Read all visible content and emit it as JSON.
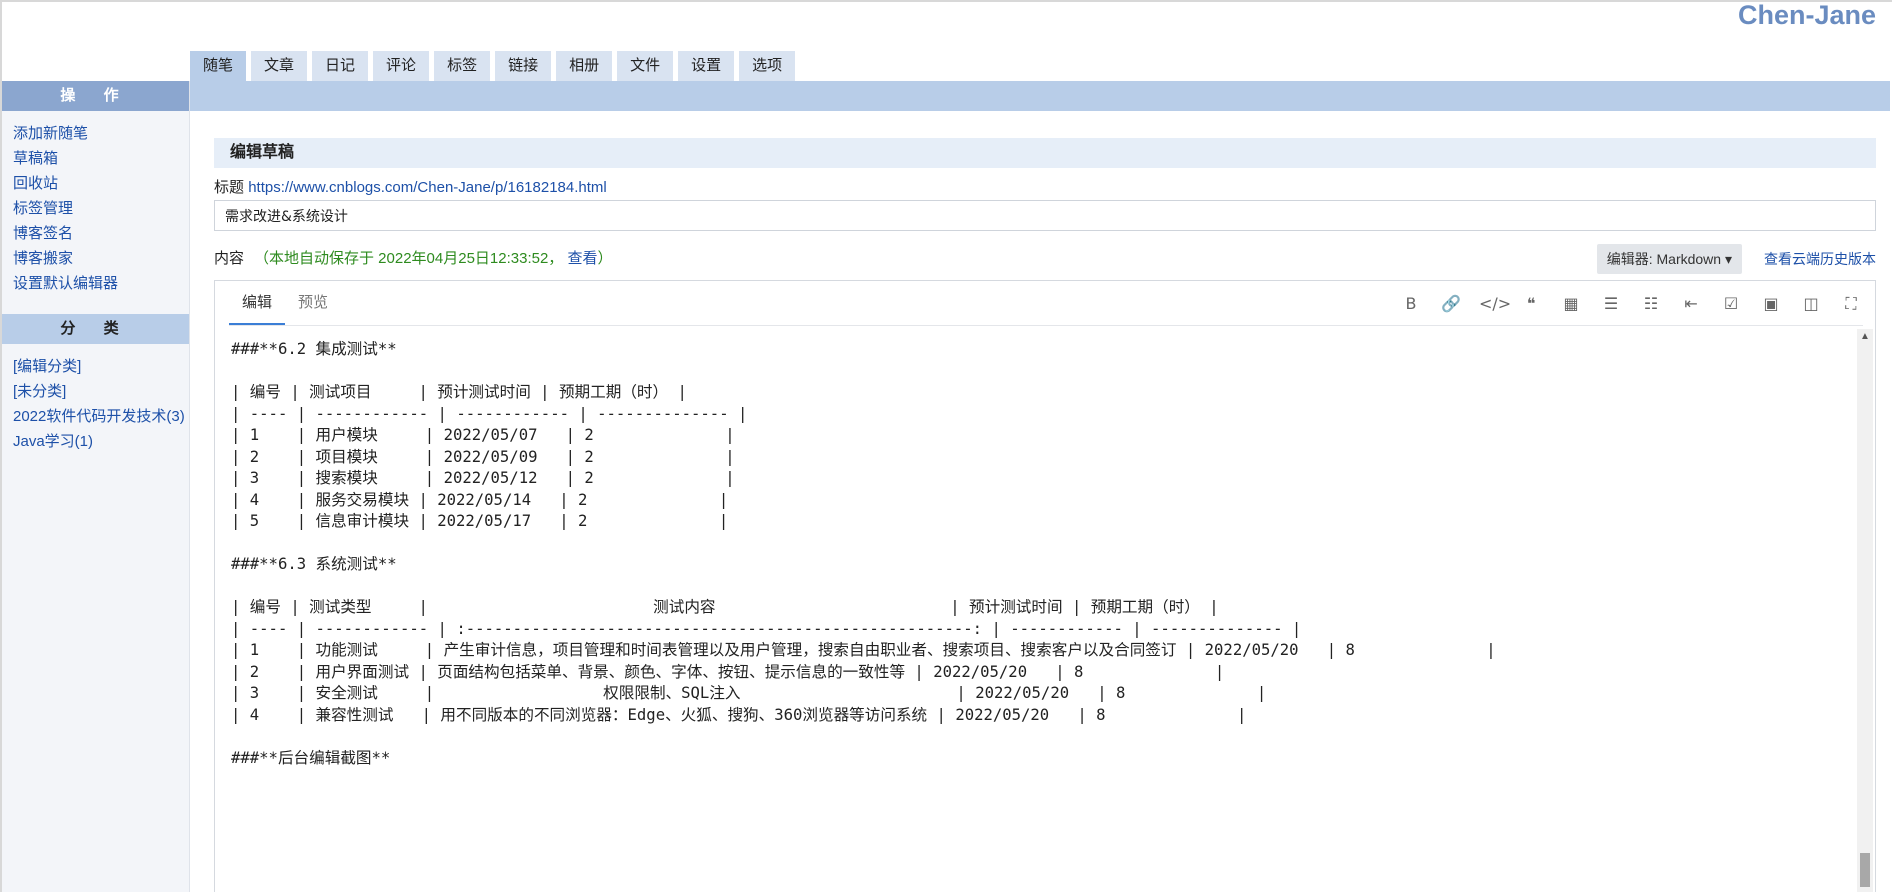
{
  "site_title": "Chen-Jane",
  "tabs": [
    "随笔",
    "文章",
    "日记",
    "评论",
    "标签",
    "链接",
    "相册",
    "文件",
    "设置",
    "选项"
  ],
  "sidebar": {
    "ops_title": "操 作",
    "ops": [
      "添加新随笔",
      "草稿箱",
      "回收站",
      "标签管理",
      "博客签名",
      "博客搬家",
      "设置默认编辑器"
    ],
    "cat_title": "分 类",
    "cats": [
      "[编辑分类]",
      "[未分类]",
      "2022软件代码开发技术(3)",
      "Java学习(1)"
    ]
  },
  "main": {
    "section_title": "编辑草稿",
    "title_label": "标题",
    "title_link": "https://www.cnblogs.com/Chen-Jane/p/16182184.html",
    "title_value": "需求改进&系统设计",
    "content_label": "内容",
    "autosave_prefix": "（本地自动保存于 2022年04月25日12:33:52，",
    "autosave_view": "查看",
    "autosave_suffix": "）",
    "editor_select": "编辑器: Markdown",
    "history_link": "查看云端历史版本"
  },
  "editor": {
    "tab_edit": "编辑",
    "tab_preview": "预览",
    "tools": [
      {
        "icon": "bold-icon",
        "glyph": "B"
      },
      {
        "icon": "link-icon",
        "glyph": "🔗"
      },
      {
        "icon": "code-icon",
        "glyph": "</>"
      },
      {
        "icon": "quote-icon",
        "glyph": "❝"
      },
      {
        "icon": "table-icon",
        "glyph": "▦"
      },
      {
        "icon": "bullet-list-icon",
        "glyph": "☰"
      },
      {
        "icon": "numbered-list-icon",
        "glyph": "☷"
      },
      {
        "icon": "indent-icon",
        "glyph": "⇤"
      },
      {
        "icon": "checkbox-icon",
        "glyph": "☑"
      },
      {
        "icon": "image-icon",
        "glyph": "▣"
      },
      {
        "icon": "split-view-icon",
        "glyph": "◫"
      },
      {
        "icon": "fullscreen-icon",
        "glyph": "⛶"
      }
    ],
    "lines": [
      "###**6.2 集成测试**",
      "",
      "| 编号 | 测试项目     | 预计测试时间 | 预期工期（时） |",
      "| ---- | ------------ | ------------ | -------------- |",
      "| 1    | 用户模块     | 2022/05/07   | 2              |",
      "| 2    | 项目模块     | 2022/05/09   | 2              |",
      "| 3    | 搜索模块     | 2022/05/12   | 2              |",
      "| 4    | 服务交易模块 | 2022/05/14   | 2              |",
      "| 5    | 信息审计模块 | 2022/05/17   | 2              |",
      "",
      "###**6.3 系统测试**",
      "",
      "| 编号 | 测试类型     |                        测试内容                         | 预计测试时间 | 预期工期（时） |",
      "| ---- | ------------ | :------------------------------------------------------: | ------------ | -------------- |",
      "| 1    | 功能测试     | 产生审计信息，项目管理和时间表管理以及用户管理，搜索自由职业者、搜索项目、搜索客户以及合同签订 | 2022/05/20   | 8              |",
      "| 2    | 用户界面测试 | 页面结构包括菜单、背景、颜色、字体、按钮、提示信息的一致性等 | 2022/05/20   | 8              |",
      "| 3    | 安全测试     |                  权限限制、SQL注入                       | 2022/05/20   | 8              |",
      "| 4    | 兼容性测试   | 用不同版本的不同浏览器：Edge、火狐、搜狗、360浏览器等访问系统 | 2022/05/20   | 8              |",
      "",
      "###**后台编辑截图**"
    ]
  }
}
